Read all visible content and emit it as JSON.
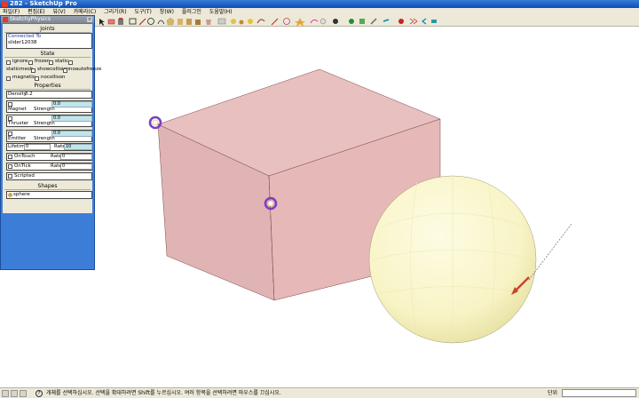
{
  "window": {
    "title": "282 - SketchUp Pro"
  },
  "menu": {
    "items": [
      "파일(F)",
      "편집(E)",
      "뷰(V)",
      "카메라(C)",
      "그리기(R)",
      "도구(T)",
      "창(W)",
      "플러그인",
      "도움말(H)"
    ]
  },
  "toolbar": {
    "icons": [
      "select-icon",
      "eraser-icon",
      "paint-icon",
      "rectangle-icon",
      "line-icon",
      "circle-icon",
      "arc-icon",
      "polygon-icon",
      "freehand-icon",
      "move-icon",
      "pushpull-icon",
      "rotate-icon",
      "followme-icon",
      "scale-icon",
      "offset-icon",
      "tape-icon",
      "dimension-icon",
      "protractor-icon",
      "text-icon",
      "axes-icon",
      "3dtext-icon",
      "orbit-icon",
      "pan-icon",
      "zoom-icon",
      "zoom-window-icon",
      "zoom-extents-icon",
      "iso-view-icon",
      "top-view-icon",
      "front-view-icon",
      "right-view-icon",
      "back-view-icon",
      "left-view-icon",
      "xray-icon",
      "wireframe-icon",
      "hidden-line-icon",
      "shaded-icon",
      "textured-icon",
      "monochrome-icon",
      "section-icon",
      "physics-play-icon",
      "physics-pause-icon",
      "physics-reset-icon",
      "joint-icon",
      "red-dot-icon",
      "magnet-icon",
      "ball-icon",
      "cursor-icon"
    ]
  },
  "panel": {
    "title": "SketchyPhysics",
    "joints_heading": "Joints",
    "connected_to_label": "Connected To",
    "connected_to_value": "slider12038",
    "state_heading": "State",
    "state_flags": {
      "ignore": "ignore",
      "frozen": "frozen",
      "static": "static",
      "staticmesh": "staticmesh",
      "showcollision": "showcollision",
      "noautofreeze": "noautofreeze",
      "magnetic": "magnetic",
      "nocollison": "nocollison"
    },
    "properties_heading": "Properties",
    "density_label": "Density",
    "density_value": "0.2",
    "magnet_label": "Magnet",
    "magnet_strength_label": "Strength",
    "magnet_strength_value": "0.0",
    "thruster_label": "Thruster",
    "thruster_strength_label": "Strength",
    "thruster_strength_value": "0.0",
    "emitter_label": "Emitter",
    "emitter_strength_label": "Strength",
    "emitter_strength_value": "0.0",
    "lifetime_label": "Lifetime",
    "lifetime_value": "0",
    "lifetime_rate_label": "Rate",
    "lifetime_rate_value": "10",
    "ontouch_label": "OnTouch",
    "ontouch_rate_label": "Rate",
    "ontouch_rate_value": "0",
    "ontick_label": "OnTick",
    "ontick_rate_label": "Rate",
    "ontick_rate_value": "0",
    "scripted_label": "Scripted",
    "shapes_heading": "Shapes",
    "shape_value": "sphere"
  },
  "status": {
    "message": "개체를 선택하십시오. 선택을 확대하려면 Shift를 누르십시오. 여러 항목을 선택하려면 마우스를 끄십시오.",
    "unit_label": "단위"
  },
  "colors": {
    "box_face": "#e3b5b5",
    "sphere": "#fbf8cf",
    "panel_bg": "#3c7dd8",
    "joint_ring": "#7b3fc4",
    "arrow": "#c8432c"
  }
}
